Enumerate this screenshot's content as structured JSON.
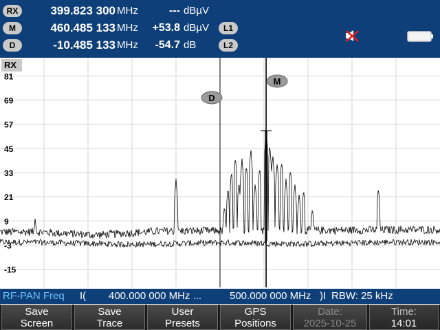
{
  "header": {
    "rows": [
      {
        "tag": "RX",
        "freq": "399.823 300",
        "freq_unit": "MHz",
        "level": "---",
        "level_unit": "dBµV"
      },
      {
        "tag": "M",
        "freq": "460.485 133",
        "freq_unit": "MHz",
        "level": "+53.8",
        "level_unit": "dBµV"
      },
      {
        "tag": "D",
        "freq": "-10.485 133",
        "freq_unit": "MHz",
        "level": "-54.7",
        "level_unit": "dB"
      }
    ],
    "line_tags": [
      "L1",
      "L2"
    ],
    "icons": {
      "mute": "speaker-muted-icon",
      "battery": "battery-icon"
    }
  },
  "plot": {
    "corner_label": "RX",
    "y_ticks": [
      "81",
      "69",
      "57",
      "45",
      "33",
      "21",
      "9",
      "-3",
      "-15"
    ],
    "marker_m_label": "M",
    "marker_d_label": "D"
  },
  "chart_data": {
    "type": "line",
    "xlabel": "",
    "ylabel": "",
    "x_range_mhz": [
      400,
      500
    ],
    "ylim": [
      -24,
      90
    ],
    "y_unit": "dBµV",
    "grid": true,
    "series": [
      {
        "name": "",
        "color": "#000000"
      },
      {
        "name": "",
        "color": "#000000"
      }
    ],
    "markers": [
      {
        "label": "M",
        "x_mhz": 460.485,
        "y": 53.8
      },
      {
        "label": "D",
        "x_mhz": 450.0,
        "y": -0.9
      }
    ],
    "peaks": [
      {
        "x_mhz": 408,
        "y": 11
      },
      {
        "x_mhz": 440,
        "y": 30
      },
      {
        "x_mhz": 451,
        "y": 17
      },
      {
        "x_mhz": 451.8,
        "y": 26
      },
      {
        "x_mhz": 452.6,
        "y": 34
      },
      {
        "x_mhz": 453.5,
        "y": 41
      },
      {
        "x_mhz": 454.3,
        "y": 29
      },
      {
        "x_mhz": 455,
        "y": 40
      },
      {
        "x_mhz": 456,
        "y": 37
      },
      {
        "x_mhz": 457,
        "y": 45
      },
      {
        "x_mhz": 458,
        "y": 28
      },
      {
        "x_mhz": 459,
        "y": 36
      },
      {
        "x_mhz": 460.5,
        "y": 53.8
      },
      {
        "x_mhz": 461.3,
        "y": 47
      },
      {
        "x_mhz": 462,
        "y": 42
      },
      {
        "x_mhz": 463,
        "y": 38
      },
      {
        "x_mhz": 464,
        "y": 39
      },
      {
        "x_mhz": 465,
        "y": 30
      },
      {
        "x_mhz": 466,
        "y": 35
      },
      {
        "x_mhz": 467,
        "y": 28
      },
      {
        "x_mhz": 468,
        "y": 23
      },
      {
        "x_mhz": 469,
        "y": 25
      },
      {
        "x_mhz": 471,
        "y": 16
      },
      {
        "x_mhz": 486,
        "y": 26
      }
    ]
  },
  "status": {
    "mode": "RF-PAN Freq",
    "start_symbol": "I(",
    "start": "400.000 000 MHz ...",
    "stop": "500.000 000 MHz",
    "stop_symbol": ")I",
    "rbw": "RBW: 25 kHz"
  },
  "softkeys": [
    {
      "line1": "Save",
      "line2": "Screen",
      "enabled": true
    },
    {
      "line1": "Save",
      "line2": "Trace",
      "enabled": true
    },
    {
      "line1": "User",
      "line2": "Presets",
      "enabled": true
    },
    {
      "line1": "GPS",
      "line2": "Positions",
      "enabled": true
    },
    {
      "line1": "Date:",
      "line2": "2025-10-25",
      "enabled": false
    },
    {
      "line1": "Time:",
      "line2": "14:01",
      "enabled": false
    }
  ]
}
